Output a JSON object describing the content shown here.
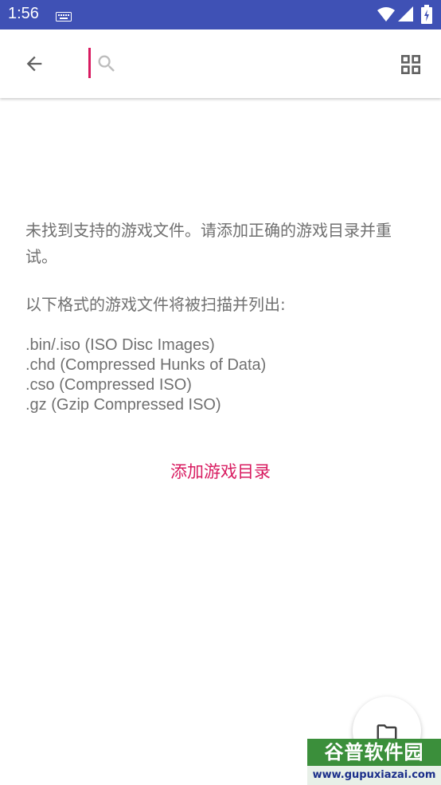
{
  "status_bar": {
    "time": "1:56",
    "icons": [
      "keyboard-icon",
      "wifi-icon",
      "signal-icon",
      "battery-icon"
    ]
  },
  "toolbar": {
    "back_icon": "arrow-back-icon",
    "search_icon": "search-icon",
    "search_value": "",
    "grid_icon": "grid-view-icon"
  },
  "main": {
    "empty_message": "未找到支持的游戏文件。请添加正确的游戏目录并重试。",
    "formats_title": "以下格式的游戏文件将被扫描并列出:",
    "formats": [
      ".bin/.iso (ISO Disc Images)",
      ".chd (Compressed Hunks of Data)",
      ".cso (Compressed ISO)",
      ".gz (Gzip Compressed ISO)"
    ],
    "add_directory_label": "添加游戏目录"
  },
  "fab": {
    "icon": "folder-icon"
  },
  "watermark": {
    "title": "谷普软件园",
    "url": "www.gupuxiazai.com"
  },
  "colors": {
    "status_bar": "#3f51b5",
    "accent": "#d81b60",
    "text": "#707070"
  }
}
